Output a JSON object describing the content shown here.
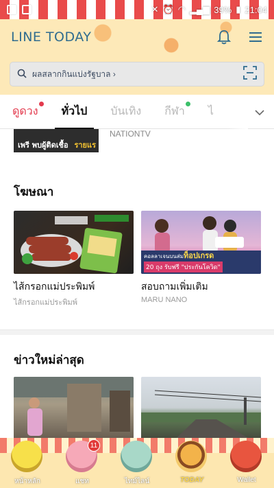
{
  "status_bar": {
    "battery": "39%",
    "time": "21:04"
  },
  "header": {
    "brand": "LINE TODAY"
  },
  "search": {
    "placeholder": "ผลสลากกินแบ่งรัฐบาล ›"
  },
  "tabs": [
    {
      "label": "ดูดวง",
      "dot": "#e33a4d"
    },
    {
      "label": "ทั่วไป",
      "active": true
    },
    {
      "label": "บันเทิง"
    },
    {
      "label": "กีฬา",
      "dot": "#3cc06a"
    },
    {
      "label": "ไ"
    }
  ],
  "previous": {
    "thumb_text_1": "เพรี พบผู้ติดเชื้อ",
    "thumb_text_2": "รายแร",
    "source": "NATIONTV"
  },
  "ads": {
    "title": "โฆษณา",
    "items": [
      {
        "title": "ไส้กรอกแม่ประพิมพ์",
        "sub": "ไส้กรอกแม่ประพิมพ์"
      },
      {
        "title": "สอบถามเพิ่มเติม",
        "sub": "MARU NANO",
        "thumb_banner_1": "คอลลาเจนบนส่ม",
        "thumb_banner_2": "ท็อปเกรด",
        "thumb_banner_3": "20 ถุง รับฟรี \"ประกันโควิด\""
      }
    ]
  },
  "latest": {
    "title": "ข่าวใหม่ล่าสุด"
  },
  "bottom_nav": [
    {
      "label": "หน้าหลัก"
    },
    {
      "label": "แชท",
      "badge": "11"
    },
    {
      "label": "ไทม์ไลน์"
    },
    {
      "label": "TODAY",
      "active": true
    },
    {
      "label": "Wallet"
    }
  ],
  "colors": {
    "accent_red": "#e33a4d",
    "brand_blue": "#2f6c8f",
    "notify_green": "#3cc06a"
  }
}
